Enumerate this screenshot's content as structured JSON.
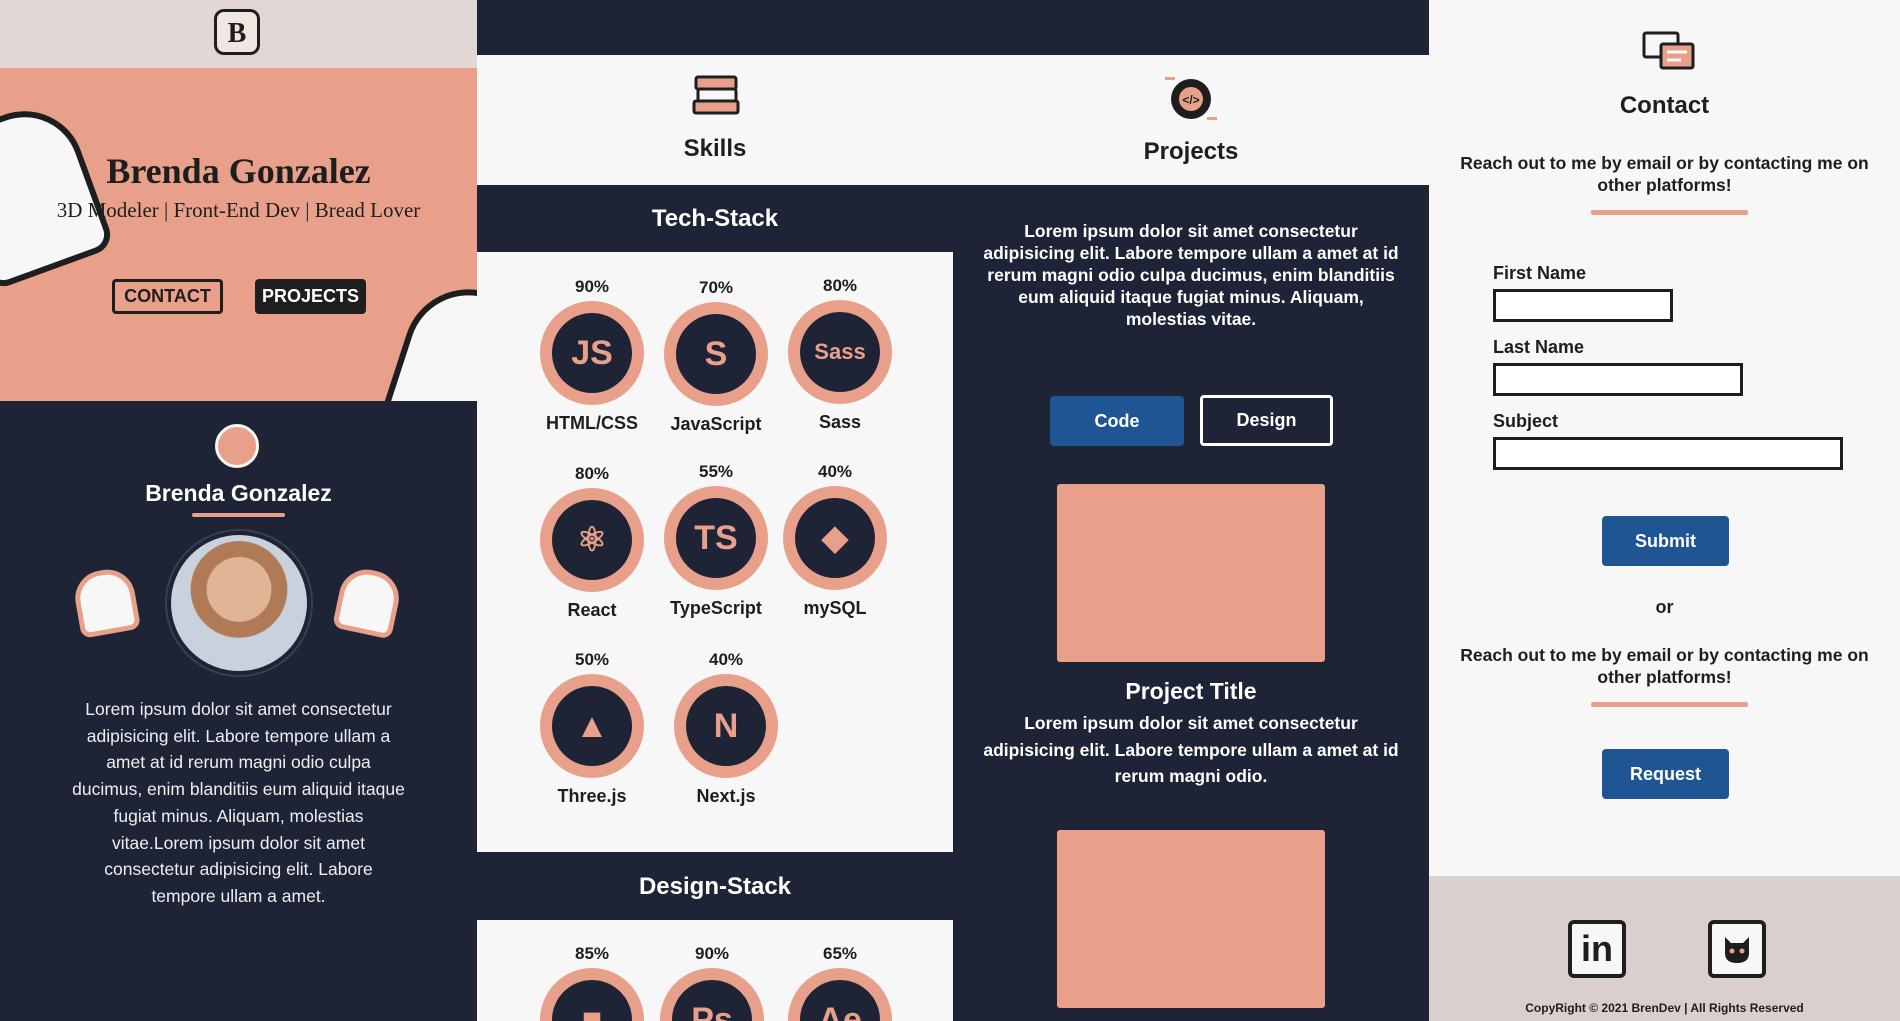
{
  "panel1": {
    "logo_text": "B",
    "hero_name": "Brenda Gonzalez",
    "hero_subtitle": "3D Modeler | Front-End Dev | Bread Lover",
    "contact_button": "CONTACT",
    "projects_button": "PROJECTS",
    "about_name": "Brenda Gonzalez",
    "about_text": "Lorem ipsum dolor sit amet consectetur adipisicing elit. Labore tempore ullam a amet at id rerum magni odio culpa ducimus, enim blanditiis eum aliquid itaque fugiat minus. Aliquam, molestias vitae.Lorem ipsum dolor sit amet consectetur adipisicing elit. Labore tempore ullam a amet."
  },
  "panel2": {
    "title": "Skills",
    "tech_title": "Tech-Stack",
    "design_title": "Design-Stack",
    "tech_skills": [
      {
        "name": "HTML/CSS",
        "percent": "90%",
        "glyph": "JS"
      },
      {
        "name": "JavaScript",
        "percent": "70%",
        "glyph": "S"
      },
      {
        "name": "Sass",
        "percent": "80%",
        "glyph": "Sass"
      },
      {
        "name": "React",
        "percent": "80%",
        "glyph": "⚛"
      },
      {
        "name": "TypeScript",
        "percent": "55%",
        "glyph": "TS"
      },
      {
        "name": "mySQL",
        "percent": "40%",
        "glyph": "◆"
      },
      {
        "name": "Three.js",
        "percent": "50%",
        "glyph": "▲"
      },
      {
        "name": "Next.js",
        "percent": "40%",
        "glyph": "N"
      }
    ],
    "design_skills": [
      {
        "percent": "85%",
        "glyph": "■"
      },
      {
        "percent": "90%",
        "glyph": "Ps"
      },
      {
        "percent": "65%",
        "glyph": "Ae"
      }
    ]
  },
  "panel3": {
    "title": "Projects",
    "intro": "Lorem ipsum dolor sit amet consectetur adipisicing elit. Labore tempore ullam a amet at id rerum magni odio culpa ducimus, enim blanditiis eum aliquid itaque fugiat minus. Aliquam, molestias vitae.",
    "tab_code": "Code",
    "tab_design": "Design",
    "project_title": "Project Title",
    "project_desc": "Lorem ipsum dolor sit amet consectetur adipisicing elit. Labore tempore ullam a amet at id rerum magni odio."
  },
  "panel4": {
    "title": "Contact",
    "intro": "Reach out to me by email or by contacting me on other platforms!",
    "first_name_label": "First Name",
    "last_name_label": "Last Name",
    "subject_label": "Subject",
    "submit_button": "Submit",
    "or_text": "or",
    "intro2": "Reach out to me by email or by contacting me on other platforms!",
    "request_button": "Request",
    "linkedin_text": "in",
    "copyright": "CopyRight © 2021 BrenDev | All Rights Reserved"
  }
}
